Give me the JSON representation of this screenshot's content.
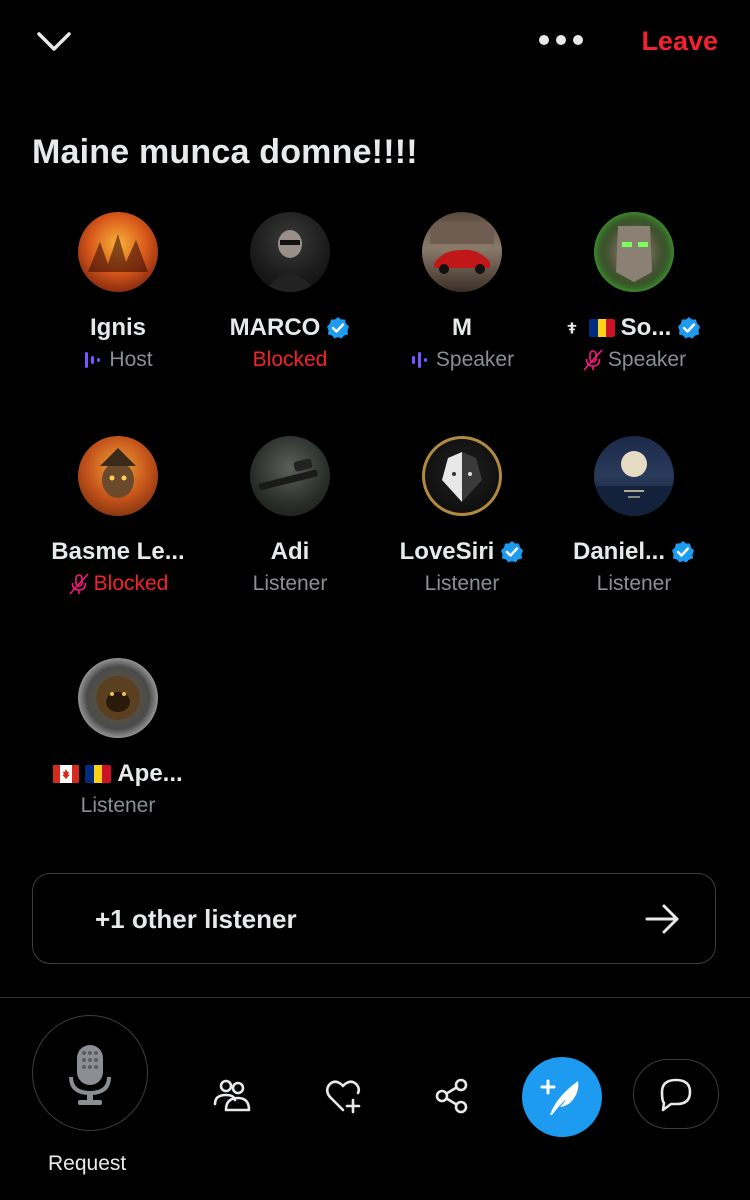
{
  "header": {
    "collapse_icon": "chevron-down-icon",
    "more_icon": "more-dots-icon",
    "leave_label": "Leave"
  },
  "space": {
    "title": "Maine munca domne!!!!"
  },
  "participants": [
    {
      "name": "Ignis",
      "role": "Host",
      "verified": false,
      "role_icon": "speaking-bars-icon",
      "avatar": "fiery-art-avatar"
    },
    {
      "name": "MARCO",
      "role": "Blocked",
      "verified": true,
      "role_icon": "",
      "avatar": "bearded-man-avatar"
    },
    {
      "name": "M",
      "role": "Speaker",
      "verified": false,
      "role_icon": "speaking-bars-icon",
      "avatar": "red-car-avatar"
    },
    {
      "name": "So...",
      "role": "Speaker",
      "verified": true,
      "role_icon": "mic-muted-icon",
      "flags": [
        "cross",
        "romania"
      ],
      "avatar": "green-mask-avatar"
    },
    {
      "name": "Basme Le...",
      "role": "Blocked",
      "verified": false,
      "role_icon": "mic-muted-icon",
      "avatar": "goblin-avatar"
    },
    {
      "name": "Adi",
      "role": "Listener",
      "verified": false,
      "role_icon": "",
      "avatar": "rifle-avatar"
    },
    {
      "name": "LoveSiri",
      "role": "Listener",
      "verified": true,
      "role_icon": "",
      "avatar": "wolf-avatar"
    },
    {
      "name": "Daniel...",
      "role": "Listener",
      "verified": true,
      "role_icon": "",
      "avatar": "moon-avatar"
    },
    {
      "name": "Ape...",
      "role": "Listener",
      "verified": false,
      "role_icon": "",
      "flags": [
        "canada",
        "romania"
      ],
      "avatar": "ape-coin-avatar"
    }
  ],
  "other_listeners": {
    "label": "+1 other listener",
    "icon": "arrow-right-icon"
  },
  "bottom_bar": {
    "request_label": "Request",
    "mic_icon": "microphone-icon",
    "people_icon": "people-icon",
    "heart_icon": "heart-plus-icon",
    "share_icon": "share-icon",
    "compose_icon": "compose-feather-icon",
    "chat_icon": "chat-bubble-icon"
  },
  "colors": {
    "background": "#000000",
    "text": "#e7e9ea",
    "muted": "#8b8f94",
    "danger": "#f4212e",
    "accent": "#1d9bf0",
    "speaking": "#7856ff",
    "verified": "#1d9bf0"
  }
}
